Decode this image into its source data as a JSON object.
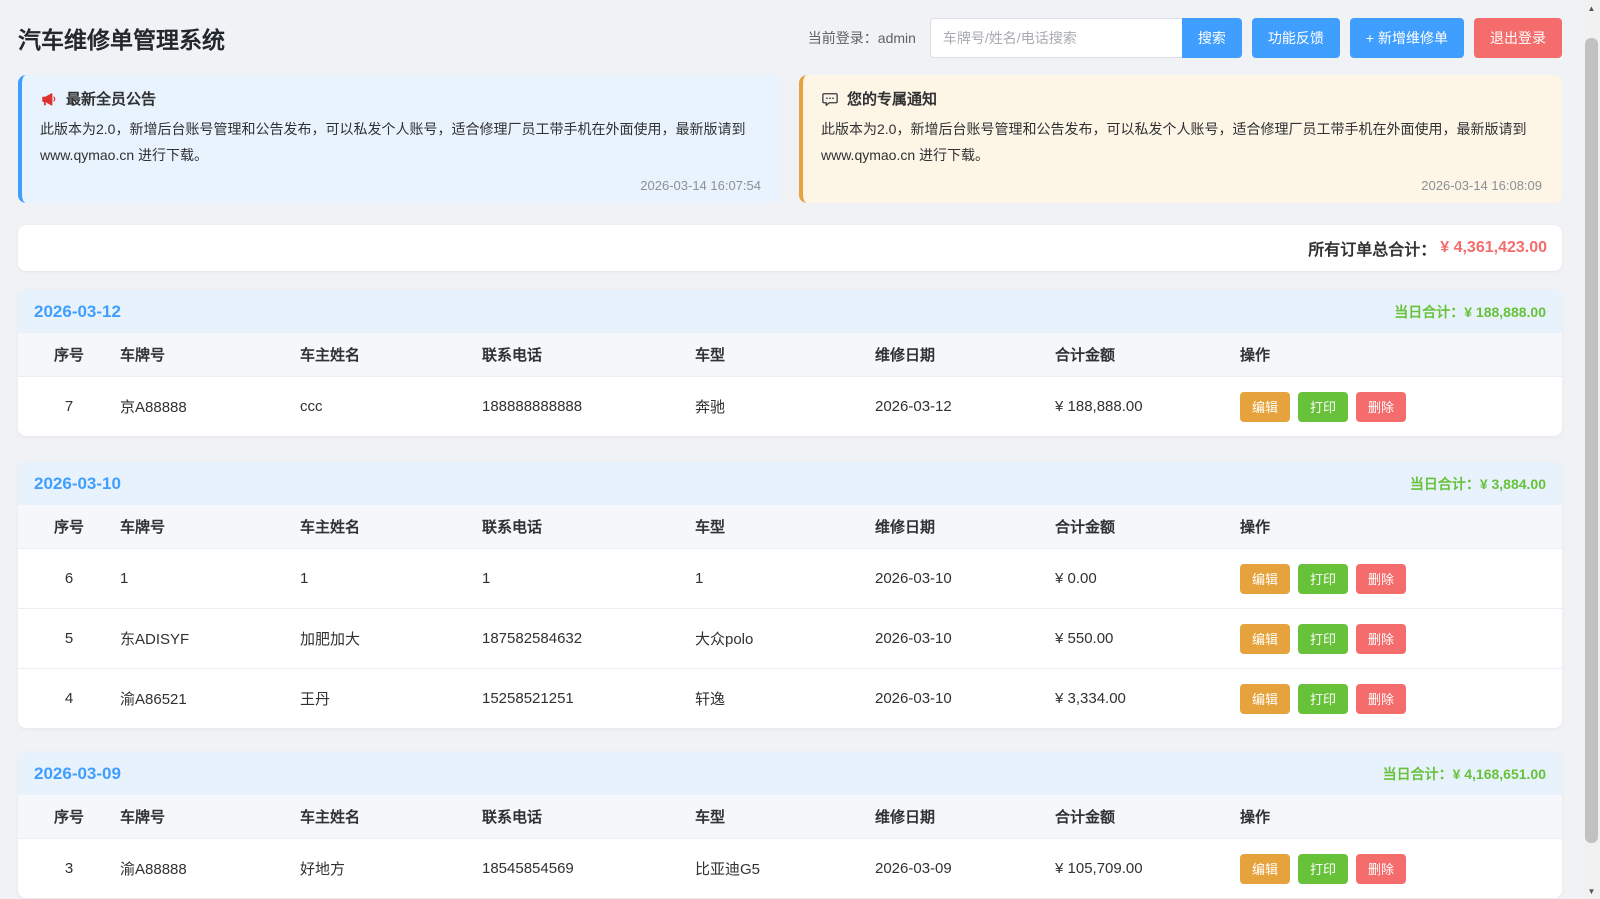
{
  "app": {
    "title": "汽车维修单管理系统"
  },
  "header": {
    "login_text": "当前登录：admin",
    "search_placeholder": "车牌号/姓名/电话搜索",
    "search_button": "搜索",
    "feedback_button": "功能反馈",
    "add_button": "+ 新增维修单",
    "logout_button": "退出登录"
  },
  "notices": [
    {
      "icon": "megaphone-icon",
      "title": "最新全员公告",
      "body": "此版本为2.0，新增后台账号管理和公告发布，可以私发个人账号，适合修理厂员工带手机在外面使用，最新版请到 www.qymao.cn 进行下载。",
      "time": "2026-03-14 16:07:54"
    },
    {
      "icon": "speech-bubble-icon",
      "title": "您的专属通知",
      "body": "此版本为2.0，新增后台账号管理和公告发布，可以私发个人账号，适合修理厂员工带手机在外面使用，最新版请到 www.qymao.cn 进行下载。",
      "time": "2026-03-14 16:08:09"
    }
  ],
  "summary": {
    "label": "所有订单总合计：",
    "amount": "¥ 4,361,423.00"
  },
  "table_headers": [
    "序号",
    "车牌号",
    "车主姓名",
    "联系电话",
    "车型",
    "维修日期",
    "合计金额",
    "操作"
  ],
  "actions": {
    "edit": "编辑",
    "print": "打印",
    "delete": "删除"
  },
  "daily_total_label": "当日合计：",
  "sections": [
    {
      "date": "2026-03-12",
      "daily_total": "¥ 188,888.00",
      "rows": [
        {
          "seq": "7",
          "plate": "京A88888",
          "owner": "ccc",
          "phone": "188888888888",
          "model": "奔驰",
          "date": "2026-03-12",
          "amount": "¥ 188,888.00"
        }
      ]
    },
    {
      "date": "2026-03-10",
      "daily_total": "¥ 3,884.00",
      "rows": [
        {
          "seq": "6",
          "plate": "1",
          "owner": "1",
          "phone": "1",
          "model": "1",
          "date": "2026-03-10",
          "amount": "¥ 0.00"
        },
        {
          "seq": "5",
          "plate": "东ADISYF",
          "owner": "加肥加大",
          "phone": "187582584632",
          "model": "大众polo",
          "date": "2026-03-10",
          "amount": "¥ 550.00"
        },
        {
          "seq": "4",
          "plate": "渝A86521",
          "owner": "王丹",
          "phone": "15258521251",
          "model": "轩逸",
          "date": "2026-03-10",
          "amount": "¥ 3,334.00"
        }
      ]
    },
    {
      "date": "2026-03-09",
      "daily_total": "¥ 4,168,651.00",
      "rows": [
        {
          "seq": "3",
          "plate": "渝A88888",
          "owner": "好地方",
          "phone": "18545854569",
          "model": "比亚迪G5",
          "date": "2026-03-09",
          "amount": "¥ 105,709.00"
        }
      ]
    }
  ],
  "colors": {
    "primary_blue": "#409eff",
    "danger_red": "#f56c6c",
    "warning_orange": "#e6a23c",
    "success_green": "#67c23a",
    "page_background": "#f0f2f5"
  }
}
